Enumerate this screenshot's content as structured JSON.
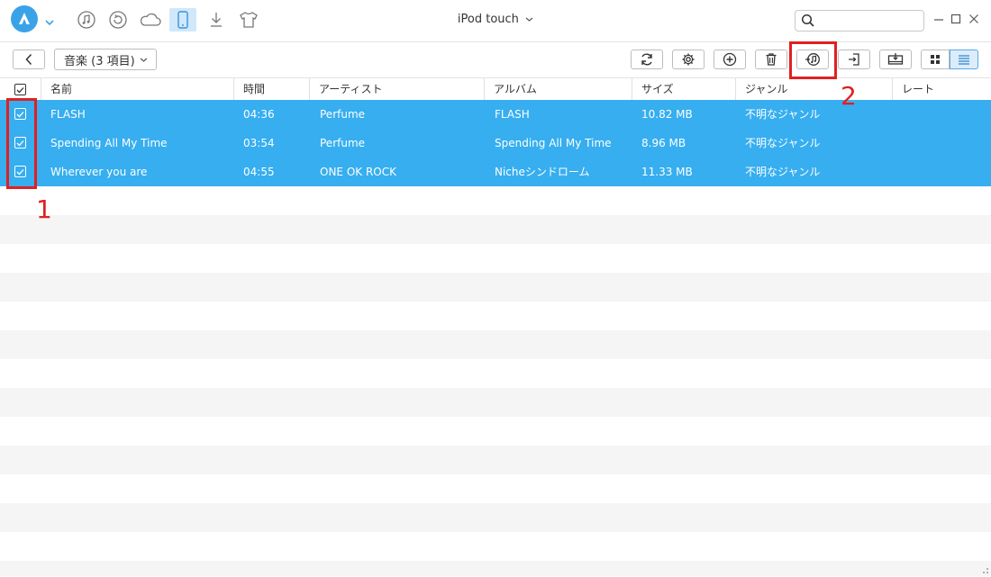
{
  "window": {
    "device_title": "iPod touch",
    "search_placeholder": ""
  },
  "top_icons": [
    "music-icon",
    "restore-icon",
    "cloud-icon",
    "phone-icon",
    "download-icon",
    "tshirt-icon"
  ],
  "toolbar": {
    "category_label": "音楽 (3 項目)"
  },
  "table": {
    "headers": [
      "名前",
      "時間",
      "アーティスト",
      "アルバム",
      "サイズ",
      "ジャンル",
      "レート"
    ],
    "rows": [
      {
        "name": "FLASH",
        "time": "04:36",
        "artist": "Perfume",
        "album": "FLASH",
        "size": "10.82 MB",
        "genre": "不明なジャンル",
        "rate": ""
      },
      {
        "name": "Spending All My Time",
        "time": "03:54",
        "artist": "Perfume",
        "album": "Spending All My Time",
        "size": "8.96 MB",
        "genre": "不明なジャンル",
        "rate": ""
      },
      {
        "name": "Wherever you are",
        "time": "04:55",
        "artist": "ONE OK ROCK",
        "album": "Nicheシンドローム",
        "size": "11.33 MB",
        "genre": "不明なジャンル",
        "rate": ""
      }
    ]
  },
  "annotations": {
    "marker_1": "1",
    "marker_2": "2"
  },
  "colors": {
    "accent": "#36aef0",
    "highlight": "#e02020",
    "stripe": "#f5f5f5"
  }
}
